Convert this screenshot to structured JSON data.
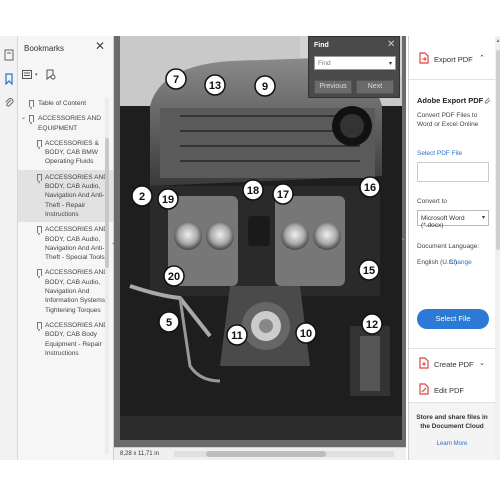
{
  "bookmarks": {
    "title": "Bookmarks",
    "items": [
      {
        "label": "Table of Content",
        "level": 0,
        "expanded": false
      },
      {
        "label": "ACCESSORIES AND EQUIPMENT",
        "level": 0,
        "expanded": true
      },
      {
        "label": "ACCESSORIES & BODY, CAB BMW Operating Fluids",
        "level": 1
      },
      {
        "label": "ACCESSORIES AND BODY, CAB Audio, Navigation And Anti-Theft - Repair Instructions",
        "level": 1,
        "selected": true
      },
      {
        "label": "ACCESSORIES AND BODY, CAB Audio, Navigation And Anti-Theft - Special Tools",
        "level": 1
      },
      {
        "label": "ACCESSORIES AND BODY, CAB Audio, Navigation And Information Systems - Tightening Torques",
        "level": 1
      },
      {
        "label": "ACCESSORIES AND BODY, CAB Body Equipment - Repair Instructions",
        "level": 1
      }
    ]
  },
  "find": {
    "title": "Find",
    "placeholder": "Find",
    "previous_label": "Previous",
    "next_label": "Next"
  },
  "document": {
    "page_size": "8,28 x 11,71 in",
    "callouts": [
      "7",
      "13",
      "9",
      "2",
      "19",
      "18",
      "17",
      "16",
      "20",
      "15",
      "5",
      "11",
      "10",
      "12"
    ]
  },
  "right_panel": {
    "export_label": "Export PDF",
    "section_title": "Adobe Export PDF",
    "description": "Convert PDF Files to Word or Excel Online",
    "select_pdf_label": "Select PDF File",
    "convert_to_label": "Convert to",
    "convert_value": "Microsoft Word (*.docx)",
    "language_label": "Document Language:",
    "language_value": "English (U.S.)",
    "change_label": "Change",
    "select_file_button": "Select File",
    "tools": [
      {
        "label": "Create PDF",
        "icon": "create-pdf-icon",
        "has_chevron": true
      },
      {
        "label": "Edit PDF",
        "icon": "edit-pdf-icon",
        "has_chevron": false
      }
    ],
    "cloud_text": "Store and share files in the Document Cloud",
    "learn_more": "Learn More"
  },
  "colors": {
    "accent": "#2d7ad6",
    "link": "#2d6fc9",
    "export_icon": "#e0423b"
  }
}
